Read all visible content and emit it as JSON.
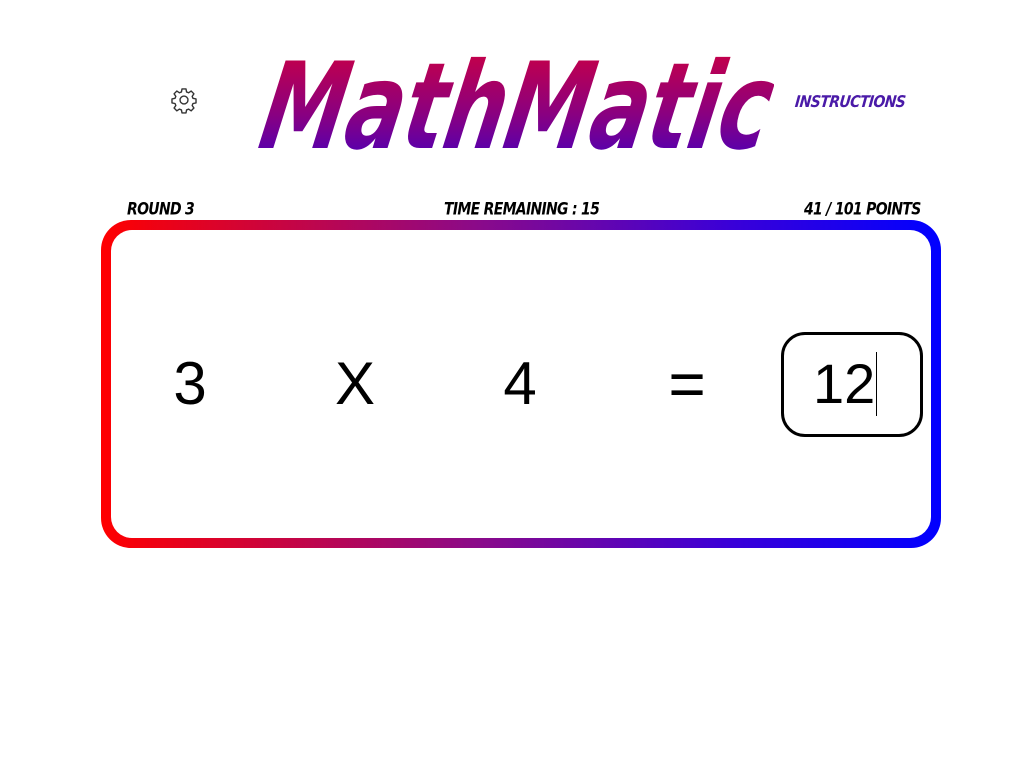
{
  "header": {
    "logo_text": "MathMatic",
    "instructions_label": "Instructions",
    "settings_icon": "gear-icon"
  },
  "status": {
    "round": "Round 3",
    "time_remaining": "Time Remaining : 15",
    "points": "41 / 101 Points"
  },
  "question": {
    "operand_a": "3",
    "operator": "X",
    "operand_b": "4",
    "equals": "="
  },
  "answer": {
    "value": "12"
  },
  "colors": {
    "logo_top": "#d4003a",
    "logo_bottom": "#3a00c8",
    "frame_left": "#ff0000",
    "frame_right": "#0000ff",
    "instructions": "#4a1aa8"
  }
}
